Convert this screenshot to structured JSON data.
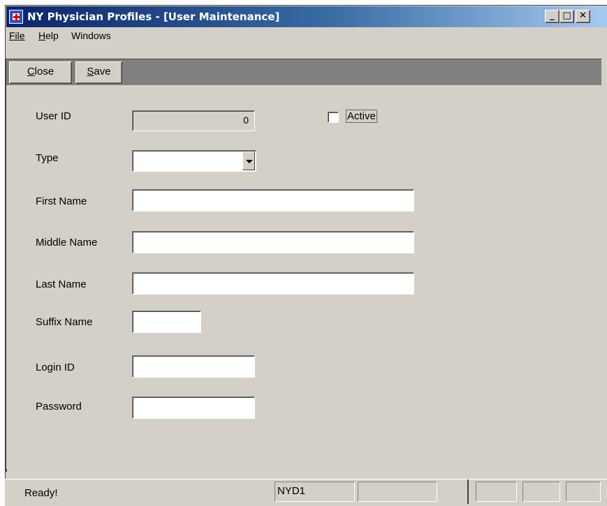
{
  "window": {
    "title": "NY Physician Profiles - [User Maintenance]",
    "controls": {
      "minimize": "_",
      "maximize": "□",
      "close": "✕"
    },
    "icon": "app-medical-cross-icon"
  },
  "menu": {
    "file": "File",
    "help": "Help",
    "windows": "Windows"
  },
  "toolbar": {
    "close_label": "Close",
    "save_label": "Save"
  },
  "form": {
    "user_id_label": "User ID",
    "user_id_value": "0",
    "active_label": "Active",
    "active_checked": false,
    "type_label": "Type",
    "type_value": "",
    "first_name_label": "First Name",
    "first_name_value": "",
    "middle_name_label": "Middle Name",
    "middle_name_value": "",
    "last_name_label": "Last Name",
    "last_name_value": "",
    "suffix_name_label": "Suffix Name",
    "suffix_name_value": "",
    "login_id_label": "Login ID",
    "login_id_value": "",
    "password_label": "Password",
    "password_value": ""
  },
  "status": {
    "text": "Ready!",
    "panel_db": "NYD1"
  },
  "colors": {
    "face": "#d4d0c8",
    "title_start": "#0a246a",
    "title_end": "#a6caf0",
    "toolbar_bg": "#808080"
  }
}
